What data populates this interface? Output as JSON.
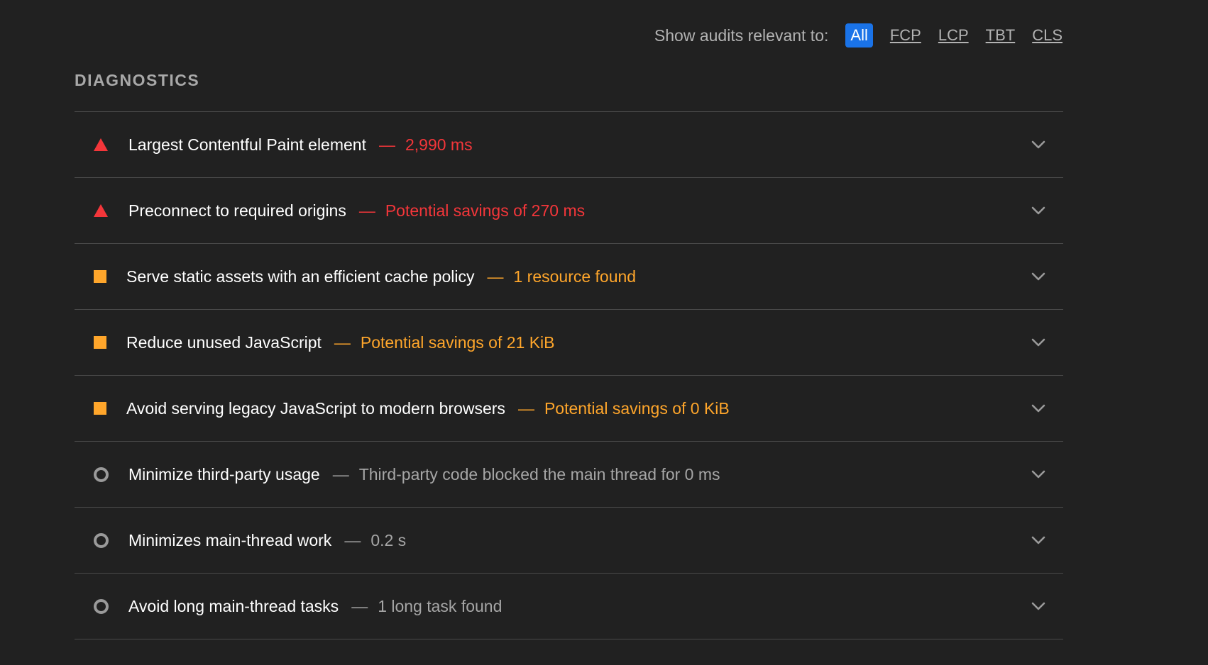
{
  "filter": {
    "label": "Show audits relevant to:",
    "options": [
      "All",
      "FCP",
      "LCP",
      "TBT",
      "CLS"
    ],
    "active": "All"
  },
  "section": {
    "title": "DIAGNOSTICS"
  },
  "colors": {
    "fail": "#f4363a",
    "average": "#ffa62b",
    "informative": "#9a9a9a",
    "accent": "#1a73e8",
    "background": "#212121"
  },
  "audits": [
    {
      "title": "Largest Contentful Paint element",
      "separator": "—",
      "value": "2,990 ms",
      "status": "fail",
      "icon": "warning-triangle-icon"
    },
    {
      "title": "Preconnect to required origins",
      "separator": "—",
      "value": "Potential savings of 270 ms",
      "status": "fail",
      "icon": "warning-triangle-icon"
    },
    {
      "title": "Serve static assets with an efficient cache policy",
      "separator": "—",
      "value": "1 resource found",
      "status": "average",
      "icon": "average-square-icon"
    },
    {
      "title": "Reduce unused JavaScript",
      "separator": "—",
      "value": "Potential savings of 21 KiB",
      "status": "average",
      "icon": "average-square-icon"
    },
    {
      "title": "Avoid serving legacy JavaScript to modern browsers",
      "separator": "—",
      "value": "Potential savings of 0 KiB",
      "status": "average",
      "icon": "average-square-icon"
    },
    {
      "title": "Minimize third-party usage",
      "separator": "—",
      "value": "Third-party code blocked the main thread for 0 ms",
      "status": "informative",
      "icon": "info-circle-icon"
    },
    {
      "title": "Minimizes main-thread work",
      "separator": "—",
      "value": "0.2 s",
      "status": "informative",
      "icon": "info-circle-icon"
    },
    {
      "title": "Avoid long main-thread tasks",
      "separator": "—",
      "value": "1 long task found",
      "status": "informative",
      "icon": "info-circle-icon"
    }
  ]
}
